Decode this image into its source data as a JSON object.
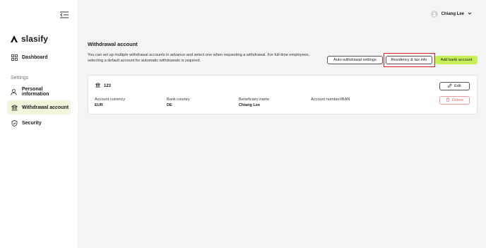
{
  "sidebar": {
    "logo_text": "slasify",
    "dashboard_label": "Dashboard",
    "settings_heading": "Settings",
    "items": [
      {
        "label": "Personal information"
      },
      {
        "label": "Withdrawal account"
      },
      {
        "label": "Security"
      }
    ]
  },
  "header": {
    "user_name": "Chiang Lee"
  },
  "main": {
    "title": "Withdrawal account",
    "description": "You can set up multiple withdrawal accounts in advance and select one when requesting a withdrawal. For full-time employees, selecting a default account for automatic withdrawals is required.",
    "buttons": {
      "auto_withdrawal": "Auto-withdrawal settings",
      "residency": "Residency & tax info",
      "add_bank": "Add bank account"
    },
    "account": {
      "name": "123",
      "fields": [
        {
          "label": "Account currency",
          "value": "EUR"
        },
        {
          "label": "Bank country",
          "value": "DE"
        },
        {
          "label": "Beneficiary name",
          "value": "Chiang Lee"
        },
        {
          "label": "Account number/IBAN",
          "value": ""
        }
      ],
      "edit_label": "Edit",
      "delete_label": "Delete"
    }
  },
  "colors": {
    "accent_green": "#c6ef56",
    "active_nav_bg": "#f1f7dd",
    "highlight_red": "#e02020",
    "delete_red": "#ee6b6b"
  }
}
